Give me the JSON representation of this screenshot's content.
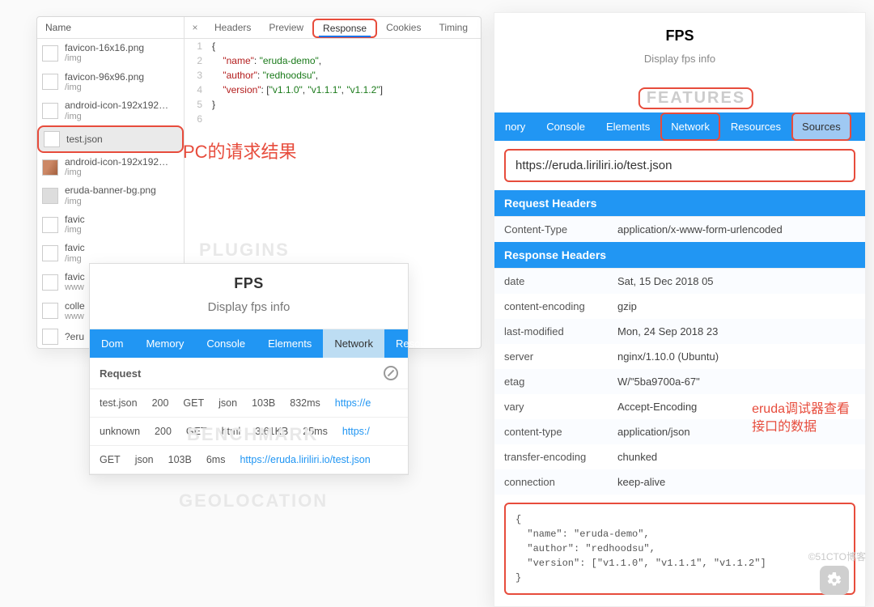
{
  "devtools": {
    "name_header": "Name",
    "tabs": {
      "headers": "Headers",
      "preview": "Preview",
      "response": "Response",
      "cookies": "Cookies",
      "timing": "Timing"
    },
    "files": [
      {
        "name": "favicon-16x16.png",
        "sub": "/img"
      },
      {
        "name": "favicon-96x96.png",
        "sub": "/img"
      },
      {
        "name": "android-icon-192x192…",
        "sub": "/img"
      },
      {
        "name": "test.json",
        "sub": ""
      },
      {
        "name": "android-icon-192x192…",
        "sub": "/img"
      },
      {
        "name": "eruda-banner-bg.png",
        "sub": "/img"
      },
      {
        "name": "favic",
        "sub": "/img"
      },
      {
        "name": "favic",
        "sub": "/img"
      },
      {
        "name": "favic",
        "sub": "www"
      },
      {
        "name": "colle",
        "sub": "www"
      },
      {
        "name": "?eru",
        "sub": ""
      }
    ],
    "code": {
      "l1": "{",
      "l2_k": "\"name\"",
      "l2_v": "\"eruda-demo\"",
      "l3_k": "\"author\"",
      "l3_v": "\"redhoodsu\"",
      "l4_k": "\"version\"",
      "l4_v1": "\"v1.1.0\"",
      "l4_v2": "\"v1.1.1\"",
      "l4_v3": "\"v1.1.2\"",
      "l5": "}"
    },
    "annotation": "PC的请求结果"
  },
  "eruda_left": {
    "card_title": "FPS",
    "card_sub": "Display fps info",
    "tabs": [
      "Dom",
      "Memory",
      "Console",
      "Elements",
      "Network",
      "Resourc"
    ],
    "request_label": "Request",
    "rows": [
      {
        "c0": "test.json",
        "c1": "200",
        "c2": "GET",
        "c3": "json",
        "c4": "103B",
        "c5": "832ms",
        "c6": "https://e"
      },
      {
        "c0": "unknown",
        "c1": "200",
        "c2": "GET",
        "c3": "html",
        "c4": "3.61KB",
        "c5": "25ms",
        "c6": "https:/"
      },
      {
        "c0": "",
        "c1": "GET",
        "c2": "json",
        "c3": "103B",
        "c4": "6ms",
        "c5": "https://eruda.liriliri.io/test.json",
        "c6": ""
      }
    ],
    "ghost1": "PLUGINS",
    "ghost2": "BENCHMARK",
    "ghost3": "GEOLOCATION"
  },
  "right": {
    "card_title": "FPS",
    "card_sub": "Display fps info",
    "features": "FEATURES",
    "tabs": [
      "nory",
      "Console",
      "Elements",
      "Network",
      "Resources",
      "Sources"
    ],
    "url": "https://eruda.liriliri.io/test.json",
    "request_headers_title": "Request Headers",
    "request_headers": [
      [
        "Content-Type",
        "application/x-www-form-urlencoded"
      ]
    ],
    "response_headers_title": "Response Headers",
    "response_headers": [
      [
        "date",
        "Sat, 15 Dec 2018 05"
      ],
      [
        "content-encoding",
        "gzip"
      ],
      [
        "last-modified",
        "Mon, 24 Sep 2018 23"
      ],
      [
        "server",
        "nginx/1.10.0 (Ubuntu)"
      ],
      [
        "etag",
        "W/\"5ba9700a-67\""
      ],
      [
        "vary",
        "Accept-Encoding"
      ],
      [
        "content-type",
        "application/json"
      ],
      [
        "transfer-encoding",
        "chunked"
      ],
      [
        "connection",
        "keep-alive"
      ]
    ],
    "json_raw": "{\n  \"name\": \"eruda-demo\",\n  \"author\": \"redhoodsu\",\n  \"version\": [\"v1.1.0\", \"v1.1.1\", \"v1.1.2\"]\n}",
    "annotation_l1": "eruda调试器查看",
    "annotation_l2": "接口的数据"
  },
  "watermark": "©51CTO博客"
}
